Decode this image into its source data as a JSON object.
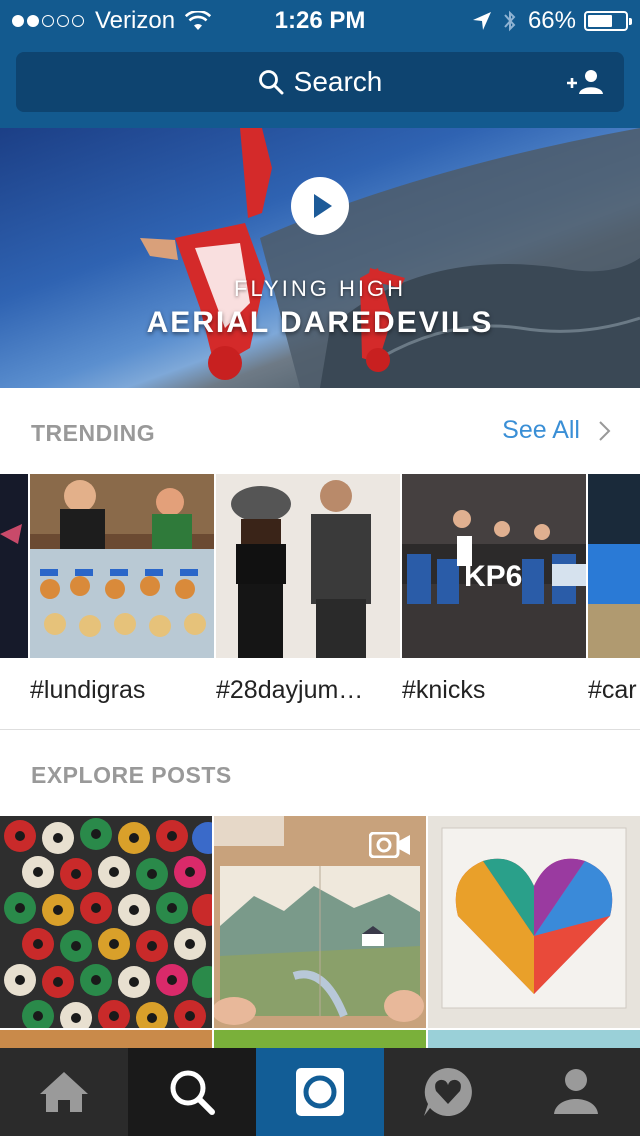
{
  "status_bar": {
    "carrier": "Verizon",
    "signal_bars": 2,
    "time": "1:26 PM",
    "battery": "66%",
    "battery_level": 0.66
  },
  "header": {
    "search_label": "Search",
    "add_user_icon": "add-user-icon"
  },
  "hero": {
    "subtitle": "FLYING HIGH",
    "title": "AERIAL DAREDEVILS",
    "play_icon": "play-icon"
  },
  "trending": {
    "heading": "TRENDING",
    "see_all": "See All",
    "tags": [
      "#lundigras",
      "#28dayjum…",
      "#knicks",
      "#car"
    ]
  },
  "explore": {
    "heading": "EXPLORE POSTS",
    "video_icon": "video-camera-icon"
  },
  "tabs": [
    {
      "name": "home",
      "icon": "home-icon"
    },
    {
      "name": "search",
      "icon": "search-icon",
      "active": true
    },
    {
      "name": "camera",
      "icon": "camera-icon"
    },
    {
      "name": "activity",
      "icon": "heart-bubble-icon"
    },
    {
      "name": "profile",
      "icon": "profile-icon"
    }
  ],
  "colors": {
    "header_bg": "#135a8f",
    "search_bg": "#0e4470",
    "link": "#3a8fd6",
    "tabbar_bg": "#2b2b2b",
    "tab_active": "#1a1a1a",
    "tab_camera": "#125d96"
  }
}
